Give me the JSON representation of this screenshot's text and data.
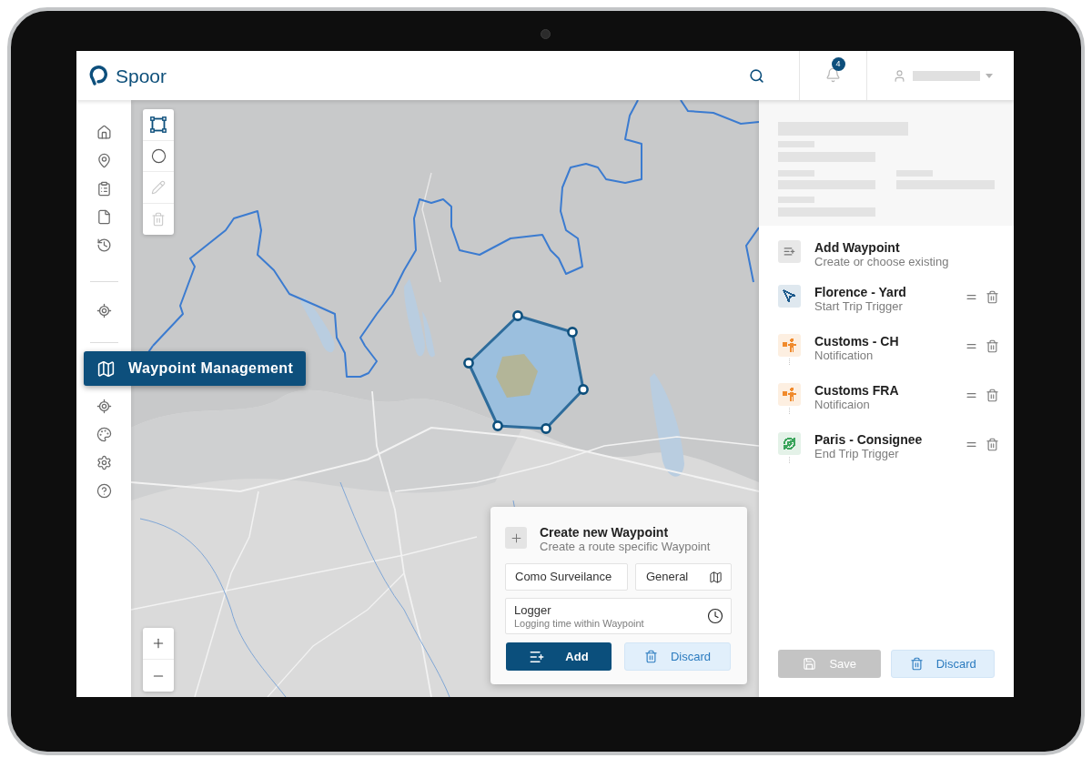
{
  "header": {
    "brand": "Spoor",
    "notifications": {
      "count": "4"
    }
  },
  "sidebar": {
    "flyout": {
      "label": "Waypoint Management"
    }
  },
  "map": {
    "draw_tools": [
      {
        "kind": "polygon",
        "selected": true,
        "disabled": false
      },
      {
        "kind": "circle",
        "selected": false,
        "disabled": false
      },
      {
        "kind": "edit",
        "selected": false,
        "disabled": true
      },
      {
        "kind": "delete",
        "selected": false,
        "disabled": true
      }
    ]
  },
  "create_panel": {
    "title": "Create new Waypoint",
    "subtitle": "Create a route specific Waypoint",
    "name_field": {
      "value": "Como Surveilance"
    },
    "type_field": {
      "value": "General"
    },
    "logger": {
      "title": "Logger",
      "subtitle": "Logging time within Waypoint"
    },
    "buttons": [
      {
        "kind": "primary",
        "label": "Add"
      },
      {
        "kind": "secondary",
        "label": "Discard"
      }
    ]
  },
  "waypoints": {
    "add": {
      "title": "Add Waypoint",
      "subtitle": "Create or choose existing"
    },
    "items": [
      {
        "kind": "start",
        "color": "#1d5a8c",
        "title": "Florence - Yard",
        "subtitle": "Start Trip Trigger"
      },
      {
        "kind": "notification",
        "color": "#f08a2c",
        "title": "Customs - CH",
        "subtitle": "Notification"
      },
      {
        "kind": "notification",
        "color": "#f08a2c",
        "title": "Customs FRA",
        "subtitle": "Notificaion"
      },
      {
        "kind": "end",
        "color": "#3ba55c",
        "title": "Paris - Consignee",
        "subtitle": "End Trip Trigger"
      }
    ]
  },
  "footer": {
    "buttons": [
      {
        "kind": "primary",
        "label": "Save",
        "disabled": true
      },
      {
        "kind": "secondary",
        "label": "Discard",
        "disabled": false
      }
    ]
  }
}
